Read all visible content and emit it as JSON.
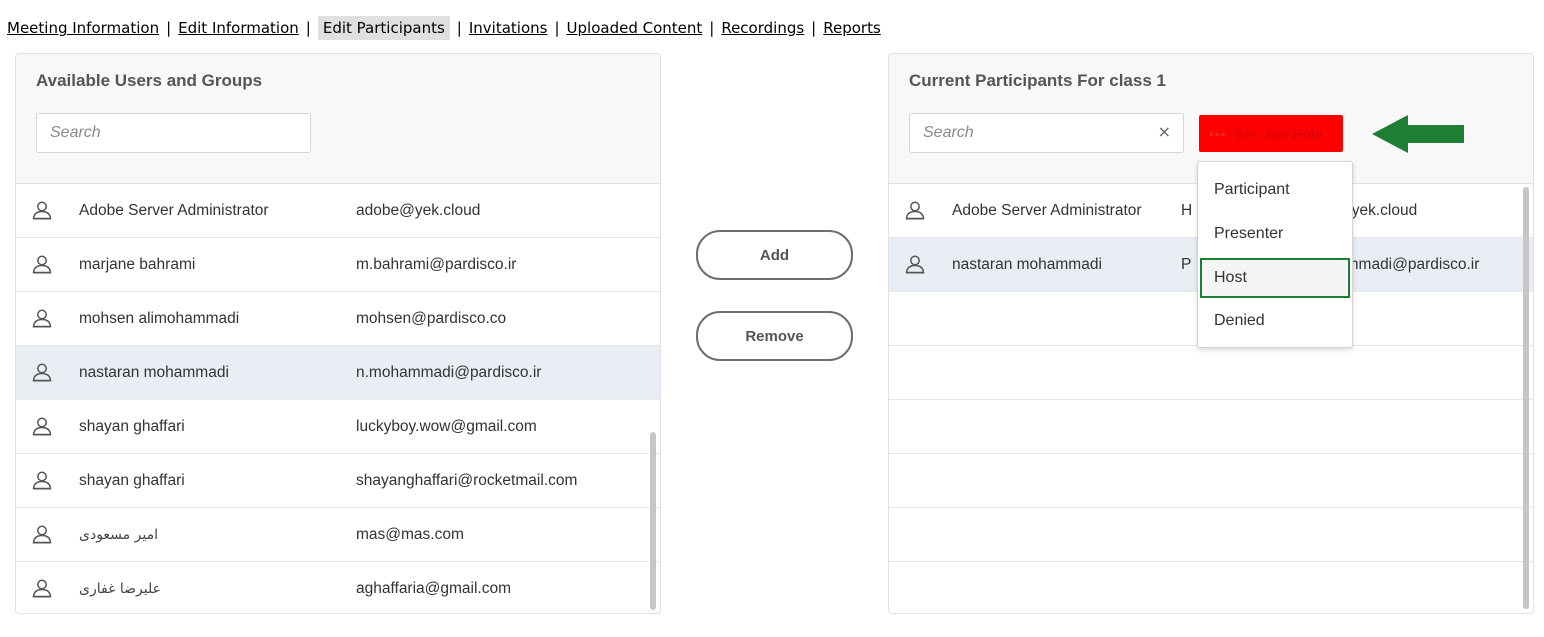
{
  "nav": {
    "items": [
      {
        "label": "Meeting Information"
      },
      {
        "label": "Edit Information"
      },
      {
        "label": "Edit Participants"
      },
      {
        "label": "Invitations"
      },
      {
        "label": "Uploaded Content"
      },
      {
        "label": "Recordings"
      },
      {
        "label": "Reports"
      }
    ],
    "separator": "|",
    "active_index": 2
  },
  "available": {
    "title": "Available Users and Groups",
    "search_placeholder": "Search",
    "rows": [
      {
        "name": "Adobe Server Administrator",
        "email": "adobe@yek.cloud",
        "selected": false
      },
      {
        "name": "marjane bahrami",
        "email": "m.bahrami@pardisco.ir",
        "selected": false
      },
      {
        "name": "mohsen alimohammadi",
        "email": "mohsen@pardisco.co",
        "selected": false
      },
      {
        "name": "nastaran mohammadi",
        "email": "n.mohammadi@pardisco.ir",
        "selected": true
      },
      {
        "name": "shayan ghaffari",
        "email": "luckyboy.wow@gmail.com",
        "selected": false
      },
      {
        "name": "shayan ghaffari",
        "email": "shayanghaffari@rocketmail.com",
        "selected": false
      },
      {
        "name": "امیر مسعودی",
        "email": "mas@mas.com",
        "selected": false
      },
      {
        "name": "علیرضا غفاری",
        "email": "aghaffaria@gmail.com",
        "selected": false
      }
    ]
  },
  "actions": {
    "add_label": "Add",
    "remove_label": "Remove"
  },
  "participants": {
    "title": "Current Participants For class 1",
    "search_placeholder": "Search",
    "clear_symbol": "×",
    "set_role_label": "Set User Role",
    "set_role_dots": "•••",
    "rows": [
      {
        "name": "Adobe Server Administrator",
        "role_initial": "H",
        "email_partial": "@yek.cloud",
        "selected": false
      },
      {
        "name": "nastaran mohammadi",
        "role_initial": "P",
        "email_partial": "ammadi@pardisco.ir",
        "selected": true
      }
    ]
  },
  "role_menu": {
    "items": [
      {
        "label": "Participant",
        "highlighted": false
      },
      {
        "label": "Presenter",
        "highlighted": false
      },
      {
        "label": "Host",
        "highlighted": true
      },
      {
        "label": "Denied",
        "highlighted": false
      }
    ]
  },
  "colors": {
    "set_role_bg": "#ff0000",
    "arrow": "#1e7e34",
    "highlight_border": "#1e7e34",
    "selected_row": "#e9edf4"
  }
}
